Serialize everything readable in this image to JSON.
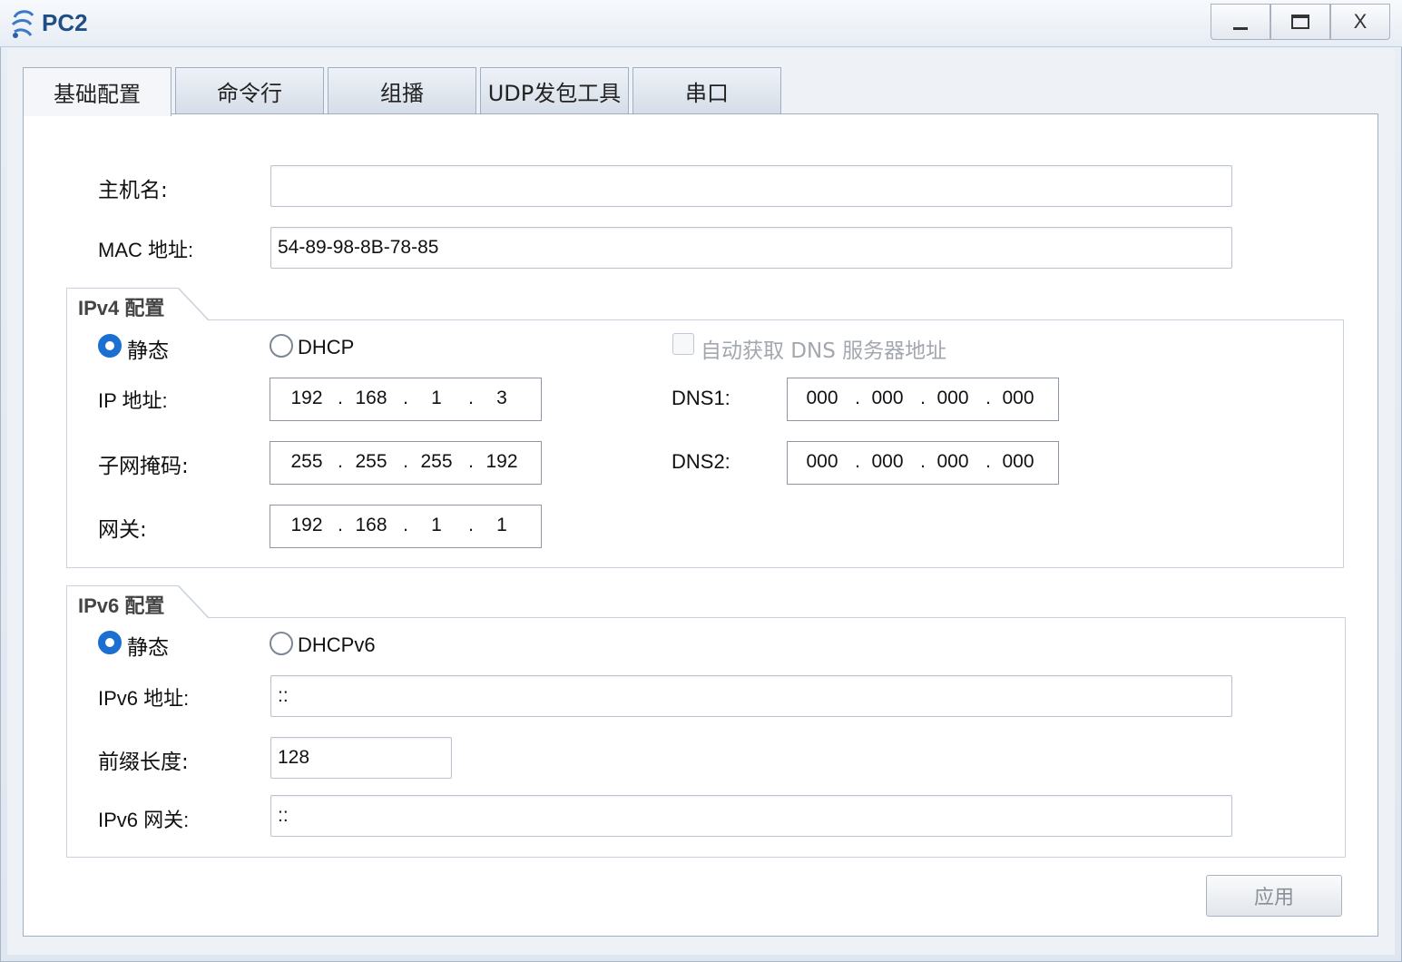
{
  "window": {
    "title": "PC2",
    "minimize_icon": "minimize-icon",
    "maximize_icon": "maximize-icon",
    "close_label": "X"
  },
  "tabs": [
    {
      "label": "基础配置",
      "active": true
    },
    {
      "label": "命令行",
      "active": false
    },
    {
      "label": "组播",
      "active": false
    },
    {
      "label": "UDP发包工具",
      "active": false
    },
    {
      "label": "串口",
      "active": false
    }
  ],
  "basic": {
    "hostname_label": "主机名:",
    "hostname_value": "",
    "mac_label": "MAC 地址:",
    "mac_value": "54-89-98-8B-78-85"
  },
  "ipv4": {
    "group_title": "IPv4 配置",
    "static_label": "静态",
    "static_checked": true,
    "dhcp_label": "DHCP",
    "dhcp_checked": false,
    "auto_dns_label": "自动获取 DNS 服务器地址",
    "auto_dns_checked": false,
    "ip_label": "IP 地址:",
    "ip": [
      "192",
      "168",
      "1",
      "3"
    ],
    "mask_label": "子网掩码:",
    "mask": [
      "255",
      "255",
      "255",
      "192"
    ],
    "gateway_label": "网关:",
    "gateway": [
      "192",
      "168",
      "1",
      "1"
    ],
    "dns1_label": "DNS1:",
    "dns1": [
      "000",
      "000",
      "000",
      "000"
    ],
    "dns2_label": "DNS2:",
    "dns2": [
      "000",
      "000",
      "000",
      "000"
    ]
  },
  "ipv6": {
    "group_title": "IPv6 配置",
    "static_label": "静态",
    "static_checked": true,
    "dhcp_label": "DHCPv6",
    "dhcp_checked": false,
    "address_label": "IPv6 地址:",
    "address_value": "::",
    "prefix_label": "前缀长度:",
    "prefix_value": "128",
    "gateway_label": "IPv6 网关:",
    "gateway_value": "::"
  },
  "apply_label": "应用",
  "colors": {
    "accent": "#1a6fd0",
    "title_text": "#1f4f86"
  }
}
